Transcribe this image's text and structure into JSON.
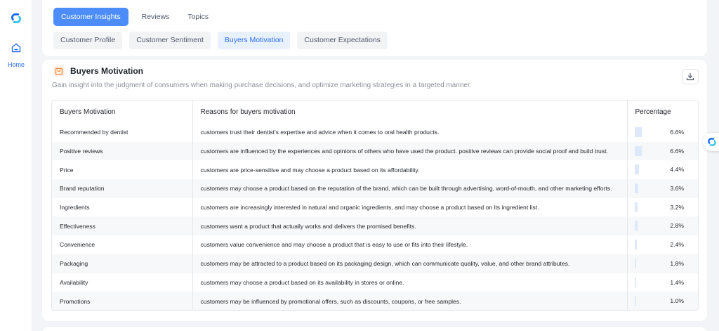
{
  "sidebar": {
    "logo_icon": "app-logo-icon",
    "home": {
      "label": "Home",
      "icon": "home-icon"
    }
  },
  "main_tabs": [
    {
      "label": "Customer Insights",
      "active": true
    },
    {
      "label": "Reviews",
      "active": false
    },
    {
      "label": "Topics",
      "active": false
    }
  ],
  "sub_tabs": [
    {
      "label": "Customer Profile",
      "active": false
    },
    {
      "label": "Customer Sentiment",
      "active": false
    },
    {
      "label": "Buyers Motivation",
      "active": true
    },
    {
      "label": "Customer Expectations",
      "active": false
    }
  ],
  "section": {
    "icon": "shopping-bag-icon",
    "title": "Buyers Motivation",
    "description": "Gain insight into the judgment of consumers when making purchase decisions, and optimize marketing strategies in a targeted manner.",
    "download_icon": "download-icon"
  },
  "table": {
    "headers": [
      "Buyers Motivation",
      "Reasons for buyers motivation",
      "Percentage"
    ],
    "rows": [
      {
        "motivation": "Recommended by dentist",
        "reason": "customers trust their dentist's expertise and advice when it comes to oral health products.",
        "percentage": "6.6%",
        "value": 6.6
      },
      {
        "motivation": "Positive reviews",
        "reason": "customers are influenced by the experiences and opinions of others who have used the product. positive reviews can provide social proof and build trust.",
        "percentage": "6.6%",
        "value": 6.6
      },
      {
        "motivation": "Price",
        "reason": "customers are price-sensitive and may choose a product based on its affordability.",
        "percentage": "4.4%",
        "value": 4.4
      },
      {
        "motivation": "Brand reputation",
        "reason": "customers may choose a product based on the reputation of the brand, which can be built through advertising, word-of-mouth, and other marketing efforts.",
        "percentage": "3.6%",
        "value": 3.6
      },
      {
        "motivation": "Ingredients",
        "reason": "customers are increasingly interested in natural and organic ingredients, and may choose a product based on its ingredient list.",
        "percentage": "3.2%",
        "value": 3.2
      },
      {
        "motivation": "Effectiveness",
        "reason": "customers want a product that actually works and delivers the promised benefits.",
        "percentage": "2.8%",
        "value": 2.8
      },
      {
        "motivation": "Convenience",
        "reason": "customers value convenience and may choose a product that is easy to use or fits into their lifestyle.",
        "percentage": "2.4%",
        "value": 2.4
      },
      {
        "motivation": "Packaging",
        "reason": "customers may be attracted to a product based on its packaging design, which can communicate quality, value, and other brand attributes.",
        "percentage": "1.8%",
        "value": 1.8
      },
      {
        "motivation": "Availability",
        "reason": "customers may choose a product based on its availability in stores or online.",
        "percentage": "1.4%",
        "value": 1.4
      },
      {
        "motivation": "Promotions",
        "reason": "customers may be influenced by promotional offers, such as discounts, coupons, or free samples.",
        "percentage": "1.0%",
        "value": 1.0
      }
    ]
  },
  "floating_button": {
    "icon": "app-logo-icon"
  },
  "colors": {
    "accent": "#4c8dfa",
    "active_text": "#2a6cf6",
    "bar_fill": "#dde9fb",
    "bag_icon": "#f58a3c"
  }
}
